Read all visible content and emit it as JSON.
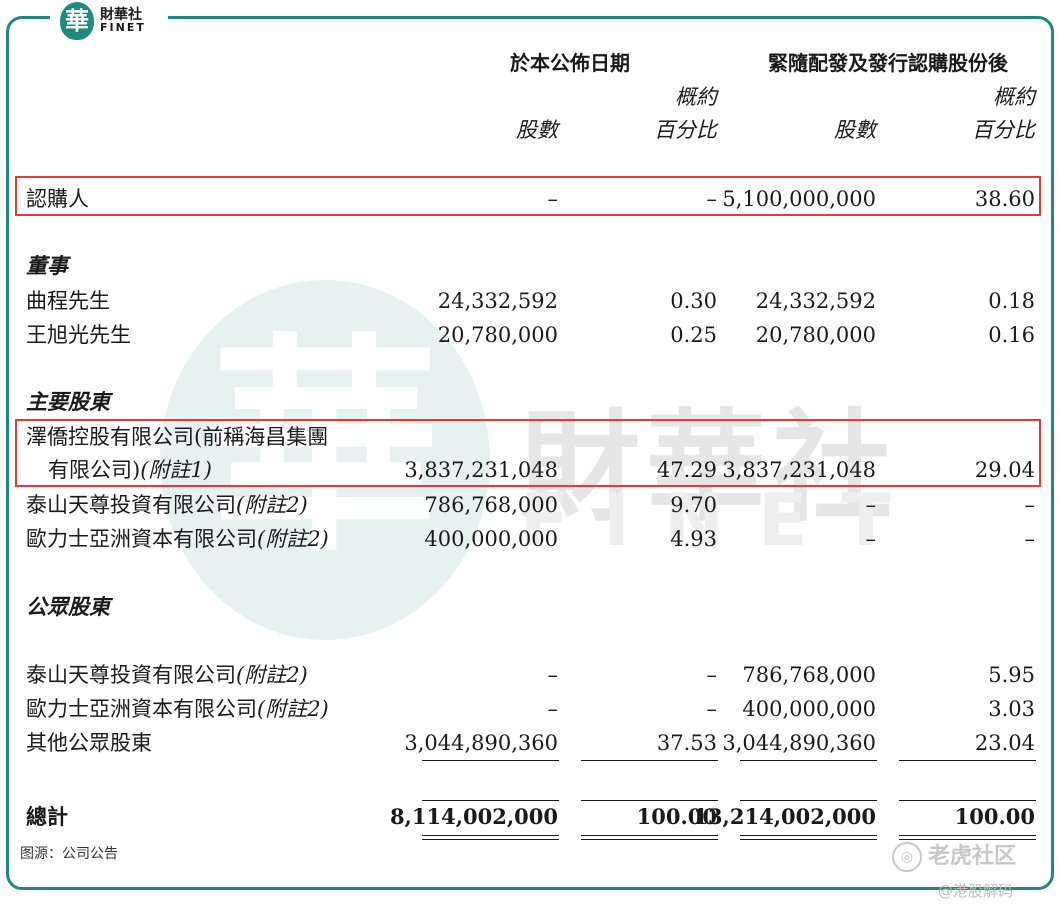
{
  "logo": {
    "mark": "華",
    "name_cn": "財華社",
    "name_en": "FINET"
  },
  "watermark": {
    "glyph": "華",
    "cn": "財華社",
    "en": "FINET",
    "tiger": "老虎社区",
    "tiger_icon": "tiger-logo-icon",
    "handle": "@港股解码"
  },
  "header": {
    "group_current": "於本公佈日期",
    "group_after": "緊隨配發及發行認購股份後",
    "shares": "股數",
    "pct_line1": "概約",
    "pct_line2": "百分比"
  },
  "subscriber": {
    "label": "認購人",
    "cur_shares": "–",
    "cur_pct": "–",
    "after_shares": "5,100,000,000",
    "after_pct": "38.60"
  },
  "directors": {
    "label": "董事",
    "rows": [
      {
        "name": "曲程先生",
        "cur_shares": "24,332,592",
        "cur_pct": "0.30",
        "after_shares": "24,332,592",
        "after_pct": "0.18"
      },
      {
        "name": "王旭光先生",
        "cur_shares": "20,780,000",
        "cur_pct": "0.25",
        "after_shares": "20,780,000",
        "after_pct": "0.16"
      }
    ]
  },
  "major": {
    "label": "主要股東",
    "rows": [
      {
        "name_line1": "澤僑控股有限公司(前稱海昌集團",
        "name_line2": "有限公司)",
        "note": "(附註1)",
        "cur_shares": "3,837,231,048",
        "cur_pct": "47.29",
        "after_shares": "3,837,231,048",
        "after_pct": "29.04"
      },
      {
        "name": "泰山天尊投資有限公司",
        "note": "(附註2)",
        "cur_shares": "786,768,000",
        "cur_pct": "9.70",
        "after_shares": "–",
        "after_pct": "–"
      },
      {
        "name": "歐力士亞洲資本有限公司",
        "note": "(附註2)",
        "cur_shares": "400,000,000",
        "cur_pct": "4.93",
        "after_shares": "–",
        "after_pct": "–"
      }
    ]
  },
  "public": {
    "label": "公眾股東",
    "rows": [
      {
        "name": "泰山天尊投資有限公司",
        "note": "(附註2)",
        "cur_shares": "–",
        "cur_pct": "–",
        "after_shares": "786,768,000",
        "after_pct": "5.95"
      },
      {
        "name": "歐力士亞洲資本有限公司",
        "note": "(附註2)",
        "cur_shares": "–",
        "cur_pct": "–",
        "after_shares": "400,000,000",
        "after_pct": "3.03"
      },
      {
        "name": "其他公眾股東",
        "cur_shares": "3,044,890,360",
        "cur_pct": "37.53",
        "after_shares": "3,044,890,360",
        "after_pct": "23.04"
      }
    ]
  },
  "total": {
    "label": "總計",
    "cur_shares": "8,114,002,000",
    "cur_pct": "100.00",
    "after_shares": "13,214,002,000",
    "after_pct": "100.00"
  },
  "source": "图源：公司公告",
  "colors": {
    "frame": "#1e8a7c",
    "highlight": "#e03c3c"
  }
}
